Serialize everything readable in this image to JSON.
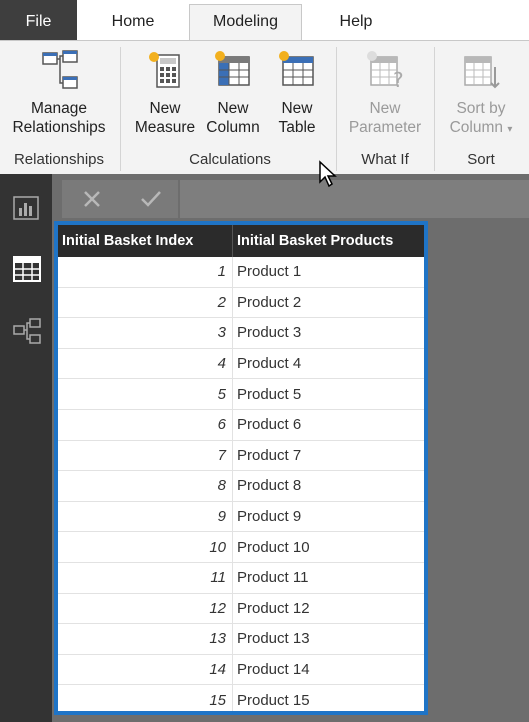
{
  "tabs": {
    "file": "File",
    "home": "Home",
    "modeling": "Modeling",
    "help": "Help"
  },
  "ribbon": {
    "manage_relationships": {
      "line1": "Manage",
      "line2": "Relationships"
    },
    "new_measure": {
      "line1": "New",
      "line2": "Measure"
    },
    "new_column": {
      "line1": "New",
      "line2": "Column"
    },
    "new_table": {
      "line1": "New",
      "line2": "Table"
    },
    "new_parameter": {
      "line1": "New",
      "line2": "Parameter"
    },
    "sort_by_column": {
      "line1": "Sort by",
      "line2": "Column"
    },
    "groups": {
      "relationships": "Relationships",
      "calculations": "Calculations",
      "what_if": "What If",
      "sort": "Sort"
    }
  },
  "formula_bar": {
    "cancel_icon": "x-icon",
    "commit_icon": "check-icon"
  },
  "left_nav": {
    "items": [
      "report-icon",
      "data-icon",
      "model-icon"
    ]
  },
  "table": {
    "headers": [
      "Initial Basket Index",
      "Initial Basket Products"
    ],
    "rows": [
      [
        "1",
        "Product 1"
      ],
      [
        "2",
        "Product 2"
      ],
      [
        "3",
        "Product 3"
      ],
      [
        "4",
        "Product 4"
      ],
      [
        "5",
        "Product 5"
      ],
      [
        "6",
        "Product 6"
      ],
      [
        "7",
        "Product 7"
      ],
      [
        "8",
        "Product 8"
      ],
      [
        "9",
        "Product 9"
      ],
      [
        "10",
        "Product 10"
      ],
      [
        "11",
        "Product 11"
      ],
      [
        "12",
        "Product 12"
      ],
      [
        "13",
        "Product 13"
      ],
      [
        "14",
        "Product 14"
      ],
      [
        "15",
        "Product 15"
      ]
    ]
  },
  "colors": {
    "accent_blue": "#1f74c6",
    "file_tab": "#3e3e3e",
    "nav_bg": "#333333",
    "header_bg": "#2b2b2b"
  }
}
